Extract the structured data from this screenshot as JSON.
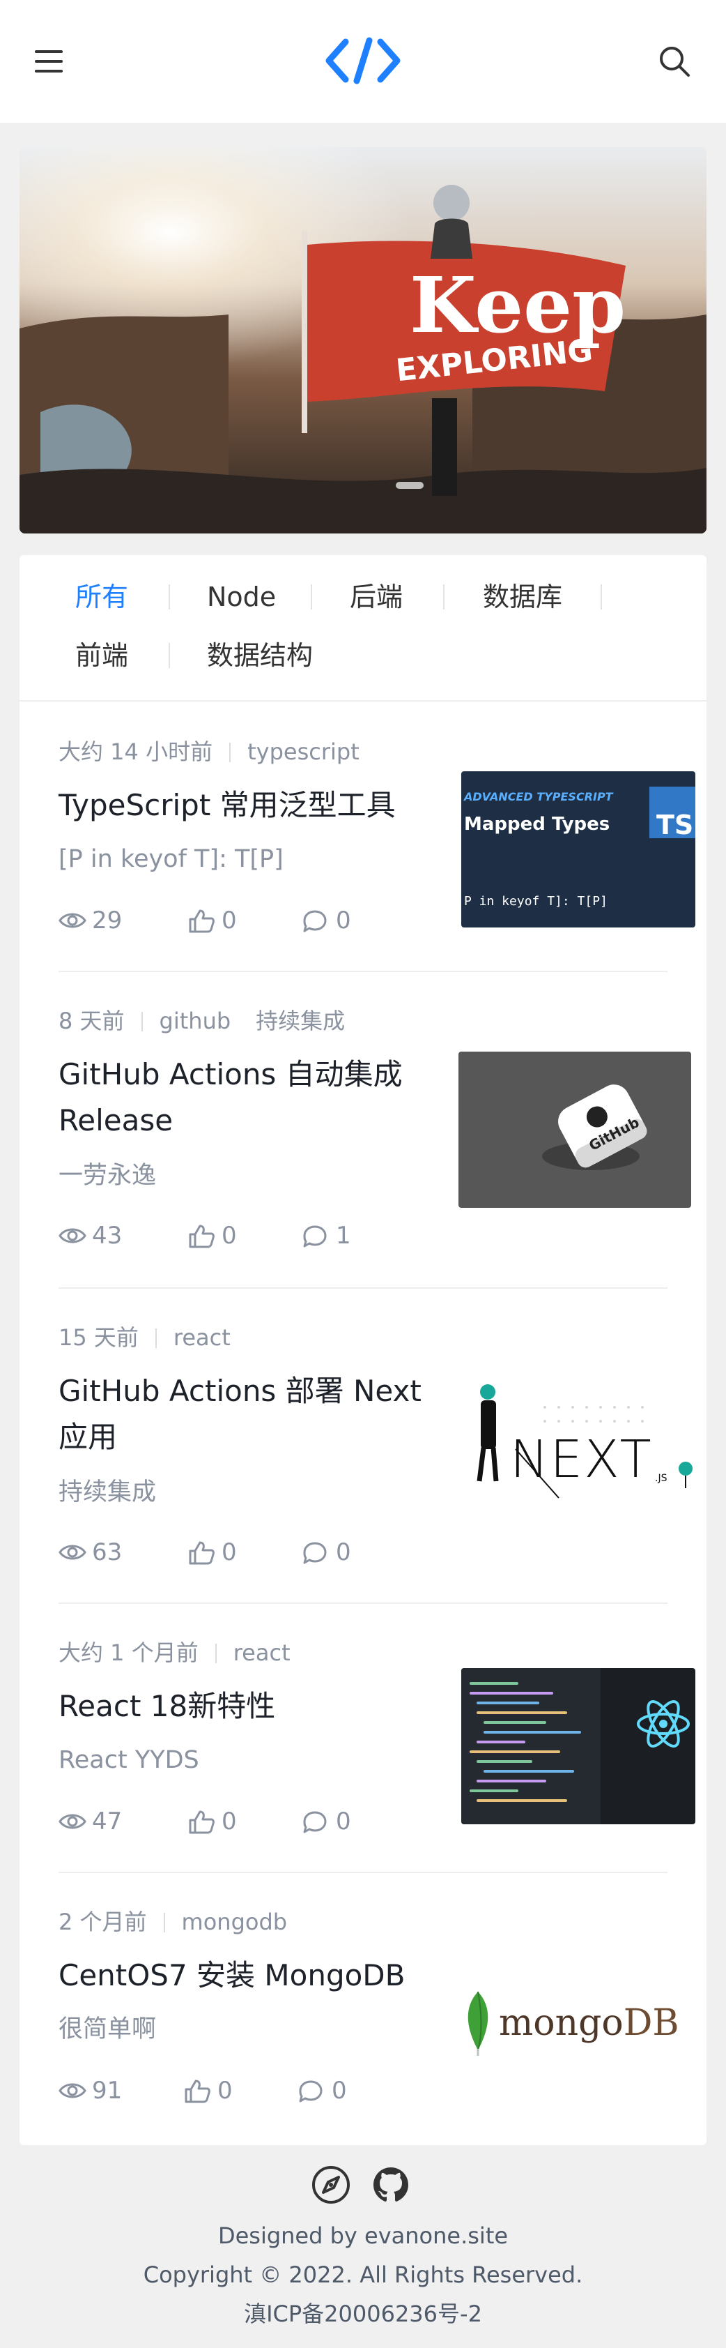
{
  "header": {
    "menu_icon": "hamburger-menu-icon",
    "logo_icon": "code-brackets-icon",
    "search_icon": "search-icon",
    "accent_color": "#1e80ff"
  },
  "banner": {
    "flag_text_top": "Keep",
    "flag_text_bottom": "EXPLORING"
  },
  "tabs": [
    {
      "label": "所有",
      "active": true
    },
    {
      "label": "Node",
      "active": false
    },
    {
      "label": "后端",
      "active": false
    },
    {
      "label": "数据库",
      "active": false
    },
    {
      "label": "前端",
      "active": false
    },
    {
      "label": "数据结构",
      "active": false
    }
  ],
  "articles": [
    {
      "time": "大约 14 小时前",
      "tags": [
        "typescript"
      ],
      "title": "TypeScript 常用泛型工具",
      "brief": "[P in keyof T]: T[P]",
      "views": "29",
      "likes": "0",
      "comments": "0",
      "thumb": {
        "line1": "ADVANCED TYPESCRIPT",
        "line2": "Mapped Types",
        "line3": "P in keyof T]: T[P]",
        "badge": "TS"
      }
    },
    {
      "time": "8 天前",
      "tags": [
        "github",
        "持续集成"
      ],
      "title": "GitHub Actions 自动集成 Release",
      "brief": "一劳永逸",
      "views": "43",
      "likes": "0",
      "comments": "1",
      "thumb": {
        "label": "GitHub"
      }
    },
    {
      "time": "15 天前",
      "tags": [
        "react"
      ],
      "title": "GitHub Actions 部署 Next 应用",
      "brief": "持续集成",
      "views": "63",
      "likes": "0",
      "comments": "0",
      "thumb": {
        "label": "NEXT",
        "sub": ".JS"
      }
    },
    {
      "time": "大约 1 个月前",
      "tags": [
        "react"
      ],
      "title": "React 18新特性",
      "brief": "React YYDS",
      "views": "47",
      "likes": "0",
      "comments": "0",
      "thumb": {}
    },
    {
      "time": "2 个月前",
      "tags": [
        "mongodb"
      ],
      "title": "CentOS7 安装 MongoDB",
      "brief": "很简单啊",
      "views": "91",
      "likes": "0",
      "comments": "0",
      "thumb": {
        "label_a": "mongo",
        "label_b": "DB"
      }
    }
  ],
  "footer": {
    "designed_by": "Designed by evanone.site",
    "copyright": "Copyright © 2022. All Rights Reserved.",
    "icp": "滇ICP备20006236号-2",
    "icons": [
      "compass-icon",
      "github-icon"
    ]
  }
}
